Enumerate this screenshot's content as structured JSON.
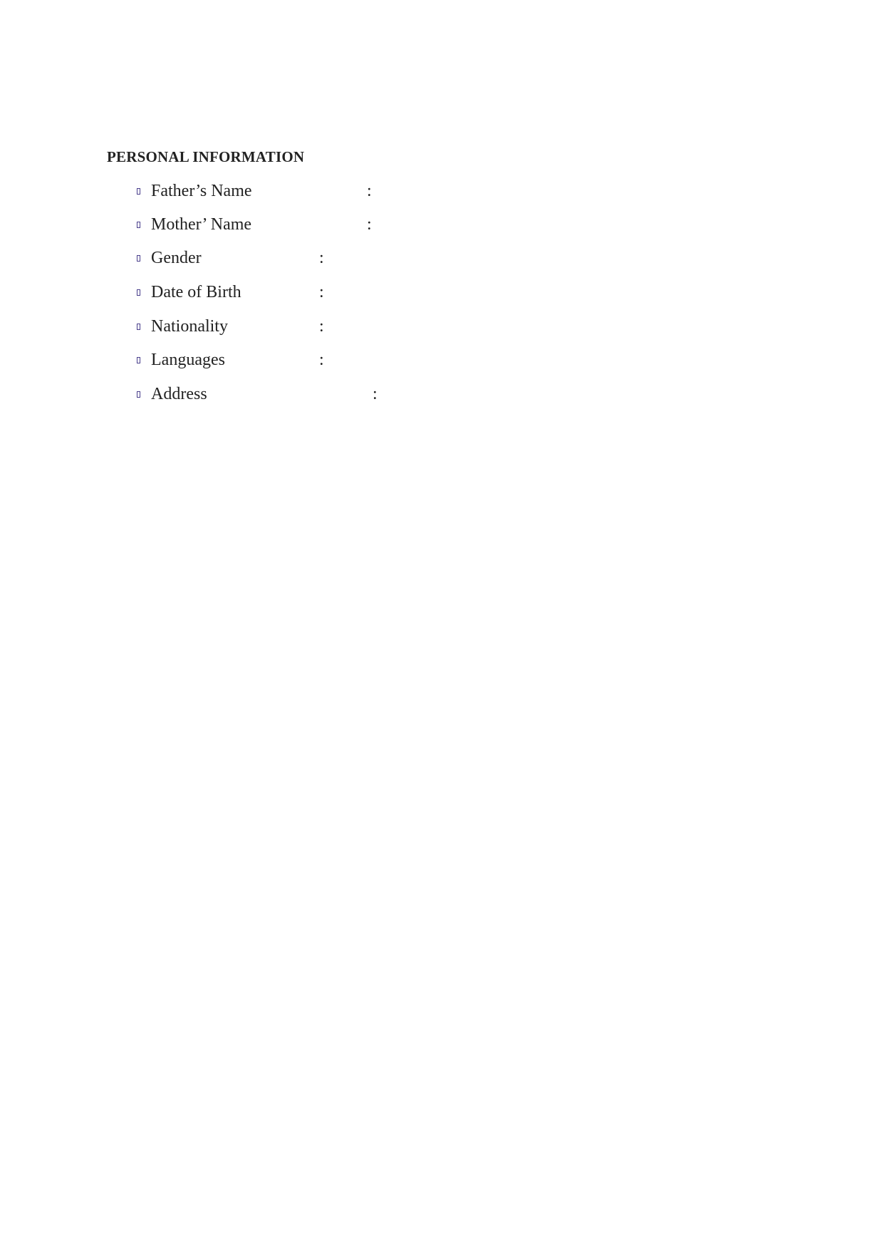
{
  "section": {
    "title": "PERSONAL INFORMATION",
    "bullet_icon": "missing-glyph-box",
    "bullet_color": "#4a3f8c",
    "fields": [
      {
        "label": "Father’s Name",
        "separator": ":",
        "value": ""
      },
      {
        "label": "Mother’ Name",
        "separator": ":",
        "value": ""
      },
      {
        "label": "Gender",
        "separator": ":",
        "value": ""
      },
      {
        "label": "Date of Birth",
        "separator": ":",
        "value": ""
      },
      {
        "label": "Nationality",
        "separator": ":",
        "value": ""
      },
      {
        "label": "Languages",
        "separator": ":",
        "value": ""
      },
      {
        "label": "Address",
        "separator": ":",
        "value": ""
      }
    ]
  }
}
